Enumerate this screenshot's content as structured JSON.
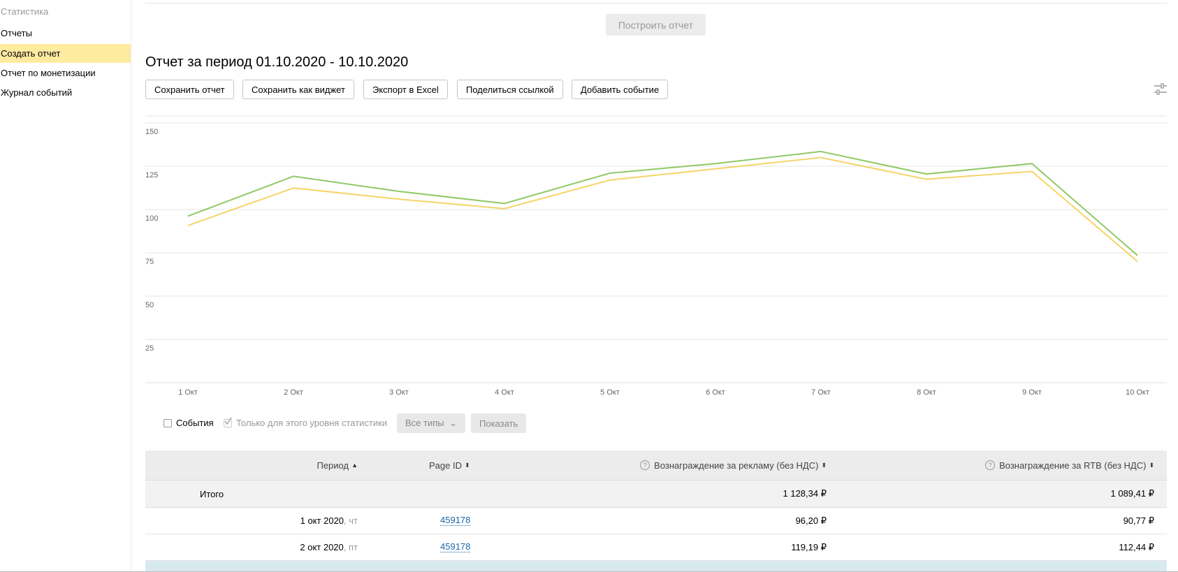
{
  "sidebar": {
    "title": "Статистика",
    "items": [
      {
        "label": "Отчеты",
        "active": false
      },
      {
        "label": "Создать отчет",
        "active": true
      },
      {
        "label": "Отчет по монетизации",
        "active": false
      },
      {
        "label": "Журнал событий",
        "active": false
      }
    ]
  },
  "build_button": "Построить отчет",
  "report_title": "Отчет за период 01.10.2020 - 10.10.2020",
  "toolbar": {
    "save": "Сохранить отчет",
    "save_widget": "Сохранить как виджет",
    "export": "Экспорт в Excel",
    "share": "Поделиться ссылкой",
    "add_event": "Добавить событие"
  },
  "chart_data": {
    "type": "line",
    "categories": [
      "1 Окт",
      "2 Окт",
      "3 Окт",
      "4 Окт",
      "5 Окт",
      "6 Окт",
      "7 Окт",
      "8 Окт",
      "9 Окт",
      "10 Окт"
    ],
    "series": [
      {
        "values": [
          96.2,
          119.19,
          110.5,
          103.5,
          121.0,
          126.5,
          133.5,
          120.5,
          126.5,
          73.5
        ],
        "color": "#8fc965"
      },
      {
        "values": [
          90.77,
          112.44,
          106.0,
          100.5,
          117.0,
          123.5,
          130.0,
          117.5,
          122.0,
          70.0
        ],
        "color": "#f5d469"
      }
    ],
    "yticks": [
      150,
      125,
      100,
      75,
      50,
      25
    ],
    "ylim": [
      0,
      150
    ],
    "grid": true
  },
  "events": {
    "checkbox_label": "События",
    "only_level_label": "Только для этого уровня статистики",
    "types_dropdown": "Все типы",
    "show_button": "Показать"
  },
  "table": {
    "headers": {
      "period": "Период",
      "page_id": "Page ID",
      "reward_ads": "Вознаграждение за рекламу (без НДС)",
      "reward_rtb": "Вознаграждение за RTB (без НДС)"
    },
    "total": {
      "label": "Итого",
      "reward_ads": "1 128,34 ₽",
      "reward_rtb": "1 089,41 ₽"
    },
    "rows": [
      {
        "date": "1 окт 2020",
        "weekday": ", чт",
        "page_id": "459178",
        "reward_ads": "96,20 ₽",
        "reward_rtb": "90,77 ₽"
      },
      {
        "date": "2 окт 2020",
        "weekday": ", пт",
        "page_id": "459178",
        "reward_ads": "119,19 ₽",
        "reward_rtb": "112,44 ₽"
      }
    ]
  },
  "colors": {
    "active_sidebar": "#ffeba0",
    "series_green": "#8fc965",
    "series_yellow": "#f5d469",
    "link": "#1a66a8"
  }
}
